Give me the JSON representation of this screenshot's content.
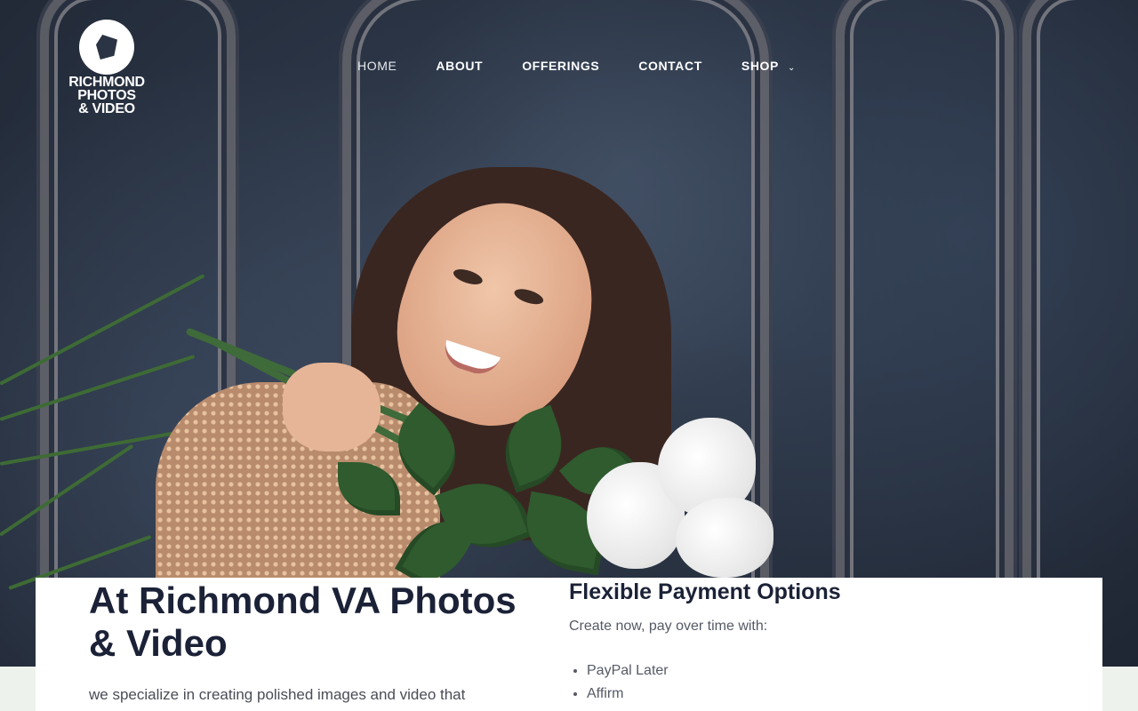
{
  "site": {
    "logo_text": "RICHMOND\nPHOTOS\n& VIDEO"
  },
  "nav": {
    "items": [
      {
        "label": "HOME",
        "active": true
      },
      {
        "label": "ABOUT"
      },
      {
        "label": "OFFERINGS"
      },
      {
        "label": "CONTACT"
      },
      {
        "label": "SHOP",
        "has_dropdown": true
      }
    ],
    "dropdown_icon": "chevron-down-icon"
  },
  "main": {
    "title": "At Richmond VA Photos & Video",
    "lead": "we specialize in creating polished images and video that"
  },
  "payments": {
    "title": "Flexible Payment Options",
    "intro": "Create now, pay over time with:",
    "options": [
      "PayPal Later",
      "Affirm"
    ]
  },
  "colors": {
    "heading": "#1b2237",
    "body_text": "#555a66",
    "page_bg": "#eef2ec",
    "hero_bg": "#2a3444"
  }
}
